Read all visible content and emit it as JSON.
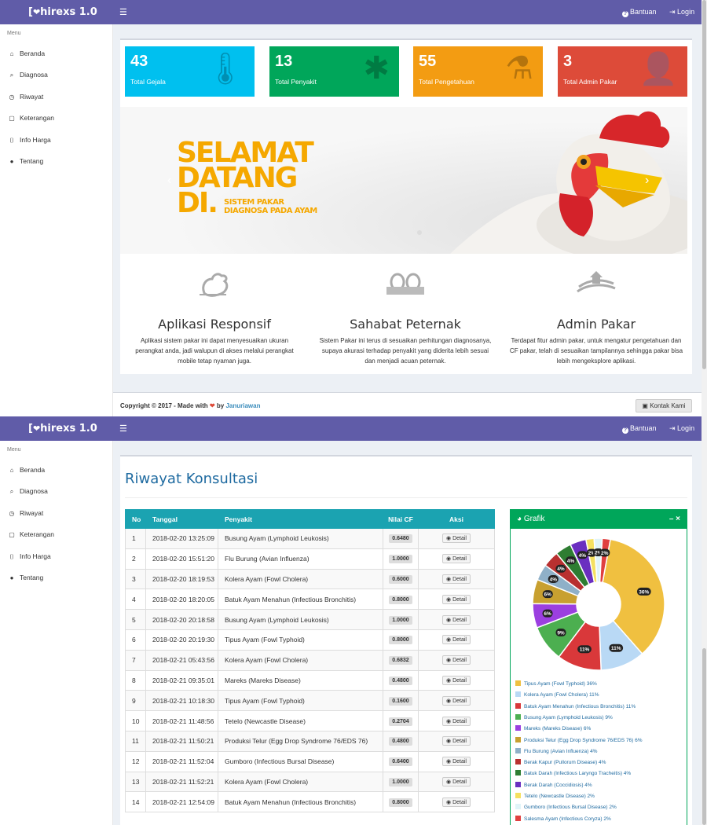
{
  "app": {
    "brand": "hirexs 1.0",
    "help": "Bantuan",
    "login": "Login"
  },
  "sidebar": {
    "header": "Menu",
    "items": [
      {
        "label": "Beranda",
        "icon": "home-icon"
      },
      {
        "label": "Diagnosa",
        "icon": "search-icon"
      },
      {
        "label": "Riwayat",
        "icon": "clock-icon"
      },
      {
        "label": "Keterangan",
        "icon": "comment-icon"
      },
      {
        "label": "Info Harga",
        "icon": "bookmark-icon"
      },
      {
        "label": "Tentang",
        "icon": "info-icon"
      }
    ]
  },
  "stats": [
    {
      "value": "43",
      "label": "Total Gejala",
      "color": "#00c0ef",
      "icon": "thermometer-icon"
    },
    {
      "value": "13",
      "label": "Total Penyakit",
      "color": "#00a65a",
      "icon": "bug-icon"
    },
    {
      "value": "55",
      "label": "Total Pengetahuan",
      "color": "#f39c12",
      "icon": "flask-icon"
    },
    {
      "value": "3",
      "label": "Total Admin Pakar",
      "color": "#dd4b39",
      "icon": "user-plus-icon"
    }
  ],
  "banner": {
    "line1": "SELAMAT",
    "line2": "DATANG",
    "line3": "DI.",
    "sub1": "SISTEM PAKAR",
    "sub2": "DIAGNOSA PADA AYAM"
  },
  "features": [
    {
      "title": "Aplikasi Responsif",
      "text": "Aplikasi sistem pakar ini dapat menyesuaikan ukuran perangkat anda, jadi walupun di akses melalui perangkat mobile tetap nyaman juga.",
      "icon": "chicken-icon"
    },
    {
      "title": "Sahabat Peternak",
      "text": "Sistem Pakar ini terus di sesuaikan perhitungan diagnosanya, supaya akurasi terhadap penyakit yang diderita lebih sesuai dan menjadi acuan peternak.",
      "icon": "eggs-icon"
    },
    {
      "title": "Admin Pakar",
      "text": "Terdapat fitur admin pakar, untuk mengatur pengetahuan dan CF pakar, telah di sesuaikan tampilannya sehingga pakar bisa lebih mengeksplore aplikasi.",
      "icon": "farm-icon"
    }
  ],
  "footer": {
    "copy": "Copyright © 2017 - Made with",
    "by": "by",
    "author": "Januriawan",
    "contact": "Kontak Kami"
  },
  "riwayat": {
    "title": "Riwayat Konsultasi",
    "columns": [
      "No",
      "Tanggal",
      "Penyakit",
      "Nilai CF",
      "Aksi"
    ],
    "detail_label": "Detail",
    "rows": [
      [
        "1",
        "2018-02-20 13:25:09",
        "Busung Ayam (Lymphoid Leukosis)",
        "0.6480"
      ],
      [
        "2",
        "2018-02-20 15:51:20",
        "Flu Burung (Avian Influenza)",
        "1.0000"
      ],
      [
        "3",
        "2018-02-20 18:19:53",
        "Kolera Ayam (Fowl Cholera)",
        "0.6000"
      ],
      [
        "4",
        "2018-02-20 18:20:05",
        "Batuk Ayam Menahun (Infectious Bronchitis)",
        "0.8000"
      ],
      [
        "5",
        "2018-02-20 20:18:58",
        "Busung Ayam (Lymphoid Leukosis)",
        "1.0000"
      ],
      [
        "6",
        "2018-02-20 20:19:30",
        "Tipus Ayam (Fowl Typhoid)",
        "0.8000"
      ],
      [
        "7",
        "2018-02-21 05:43:56",
        "Kolera Ayam (Fowl Cholera)",
        "0.6832"
      ],
      [
        "8",
        "2018-02-21 09:35:01",
        "Mareks (Mareks Disease)",
        "0.4800"
      ],
      [
        "9",
        "2018-02-21 10:18:30",
        "Tipus Ayam (Fowl Typhoid)",
        "0.1600"
      ],
      [
        "10",
        "2018-02-21 11:48:56",
        "Tetelo (Newcastle Disease)",
        "0.2704"
      ],
      [
        "11",
        "2018-02-21 11:50:21",
        "Produksi Telur (Egg Drop Syndrome 76/EDS 76)",
        "0.4800"
      ],
      [
        "12",
        "2018-02-21 11:52:04",
        "Gumboro (Infectious Bursal Disease)",
        "0.6400"
      ],
      [
        "13",
        "2018-02-21 11:52:21",
        "Kolera Ayam (Fowl Cholera)",
        "1.0000"
      ],
      [
        "14",
        "2018-02-21 12:54:09",
        "Batuk Ayam Menahun (Infectious Bronchitis)",
        "0.8000"
      ]
    ]
  },
  "chart_title": "Grafik",
  "chart_tools": "–  ×",
  "chart_data": {
    "type": "pie",
    "title": "Grafik",
    "slices": [
      {
        "name": "Tipus Ayam (Fowl Typhoid)",
        "value": 36,
        "label": "36%",
        "color": "#f0c040"
      },
      {
        "name": "Kolera Ayam (Fowl Cholera)",
        "value": 11,
        "label": "11%",
        "color": "#b9d9f5"
      },
      {
        "name": "Batuk Ayam Menahun (Infectious Bronchitis)",
        "value": 11,
        "label": "11%",
        "color": "#d9383a"
      },
      {
        "name": "Busung Ayam (Lymphoid Leukosis)",
        "value": 9,
        "label": "9%",
        "color": "#4caf50"
      },
      {
        "name": "Mareks (Mareks Disease)",
        "value": 6,
        "label": "6%",
        "color": "#9b3fe0"
      },
      {
        "name": "Produksi Telur (Egg Drop Syndrome 76/EDS 76)",
        "value": 6,
        "label": "6%",
        "color": "#c8a030"
      },
      {
        "name": "Flu Burung (Avian Influenza)",
        "value": 4,
        "label": "4%",
        "color": "#8fb0c8"
      },
      {
        "name": "Berak Kapur (Pullorum Disease)",
        "value": 4,
        "label": "4%",
        "color": "#b83030"
      },
      {
        "name": "Batuk Darah (Infectious Laryngo Tracheitis)",
        "value": 4,
        "label": "4%",
        "color": "#2e7d32"
      },
      {
        "name": "Berak Darah (Coccidiosis)",
        "value": 4,
        "label": "4%",
        "color": "#6a2fc0"
      },
      {
        "name": "Tetelo (Newcastle Disease)",
        "value": 2,
        "label": "2%",
        "color": "#f5e060"
      },
      {
        "name": "Gumboro (Infectious Bursal Disease)",
        "value": 2,
        "label": "2%",
        "color": "#e0f4f8"
      },
      {
        "name": "Salesma Ayam (Infectious Coryza)",
        "value": 2,
        "label": "2%",
        "color": "#e04040"
      }
    ]
  }
}
